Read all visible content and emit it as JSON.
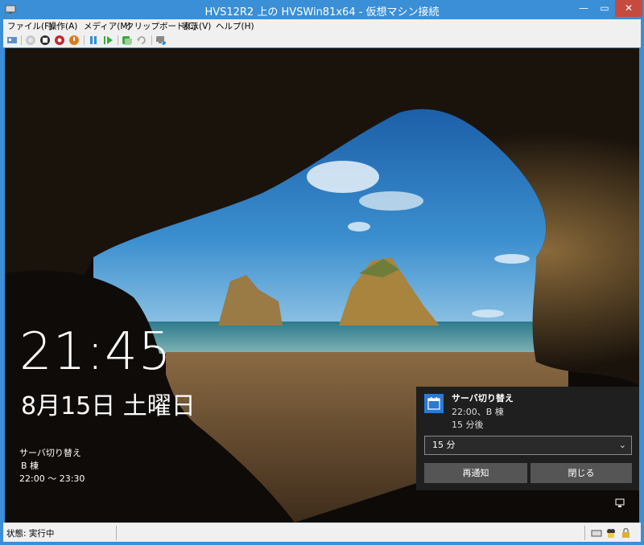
{
  "window": {
    "title": "HVS12R2 上の HVSWin81x64 - 仮想マシン接続",
    "controls": {
      "minimize": "—",
      "maximize": "▭",
      "close": "✕"
    }
  },
  "menu": [
    "ファイル(F)",
    "操作(A)",
    "メディア(M)",
    "クリップボード(C)",
    "表示(V)",
    "ヘルプ(H)"
  ],
  "toolbar": {
    "icons": [
      "ctrl-alt-del-icon",
      "start-icon",
      "turn-off-icon",
      "shutdown-icon",
      "save-icon",
      "pause-icon",
      "resume-icon",
      "checkpoint-icon",
      "revert-icon",
      "enhanced-session-icon"
    ]
  },
  "lockscreen": {
    "time": "21:45",
    "date": "8月15日 土曜日",
    "event_title": "サーバ切り替え",
    "event_location": "B 棟",
    "event_time": "22:00 ～ 23:30"
  },
  "toast": {
    "title": "サーバ切り替え",
    "line1": "22:00、B 棟",
    "line2": "15 分後",
    "snooze_value": "15 分",
    "snooze_button": "再通知",
    "dismiss_button": "閉じる"
  },
  "status": {
    "text": "状態: 実行中"
  },
  "colors": {
    "titlebar": "#3a8fd6",
    "close": "#c74a3f",
    "toast_bg": "#1f1f1f",
    "calendar_icon": "#2b79d3"
  }
}
